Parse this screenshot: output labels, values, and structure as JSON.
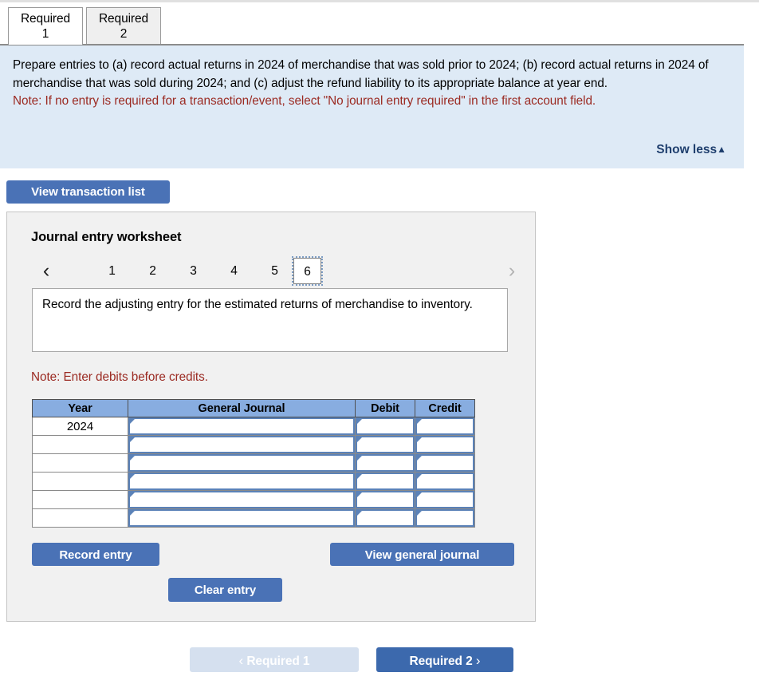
{
  "tabs": [
    {
      "label_line1": "Required",
      "label_line2": "1",
      "active": true
    },
    {
      "label_line1": "Required",
      "label_line2": "2",
      "active": false
    }
  ],
  "instructions": {
    "body": "Prepare entries to (a) record actual returns in 2024 of merchandise that was sold prior to 2024; (b) record actual returns in 2024 of merchandise that was sold during 2024; and (c) adjust the refund liability to its appropriate balance at year end.",
    "note": "Note: If no entry is required for a transaction/event, select \"No journal entry required\" in the first account field.",
    "show_less_label": "Show less",
    "show_less_caret": "▲",
    "panel_color": "#deeaf6",
    "note_color": "#9b2a22",
    "link_color": "#1f3f6e"
  },
  "toolbar": {
    "view_transaction_list_label": "View transaction list"
  },
  "worksheet": {
    "title": "Journal entry worksheet",
    "pager": {
      "prev_icon": "‹",
      "next_icon": "›",
      "pages": [
        "1",
        "2",
        "3",
        "4",
        "5",
        "6"
      ],
      "current": "6",
      "prev_enabled": true,
      "next_enabled": false
    },
    "description": "Record the adjusting entry for the estimated returns of merchandise to inventory.",
    "debits_note": "Note: Enter debits before credits.",
    "table": {
      "headers": [
        "Year",
        "General Journal",
        "Debit",
        "Credit"
      ],
      "header_color": "#88ade0",
      "rows": [
        {
          "year": "2024",
          "general_journal": "",
          "debit": "",
          "credit": ""
        },
        {
          "year": "",
          "general_journal": "",
          "debit": "",
          "credit": ""
        },
        {
          "year": "",
          "general_journal": "",
          "debit": "",
          "credit": ""
        },
        {
          "year": "",
          "general_journal": "",
          "debit": "",
          "credit": ""
        },
        {
          "year": "",
          "general_journal": "",
          "debit": "",
          "credit": ""
        },
        {
          "year": "",
          "general_journal": "",
          "debit": "",
          "credit": ""
        }
      ]
    },
    "buttons": {
      "record_entry": "Record entry",
      "clear_entry": "Clear entry",
      "view_general_journal": "View general journal"
    }
  },
  "footer_nav": {
    "prev_label": "Required 1",
    "prev_chevron": "‹",
    "prev_enabled": false,
    "next_label": "Required 2",
    "next_chevron": "›",
    "next_enabled": true,
    "active_color": "#3c69ad",
    "disabled_color": "#d5e0ef"
  }
}
